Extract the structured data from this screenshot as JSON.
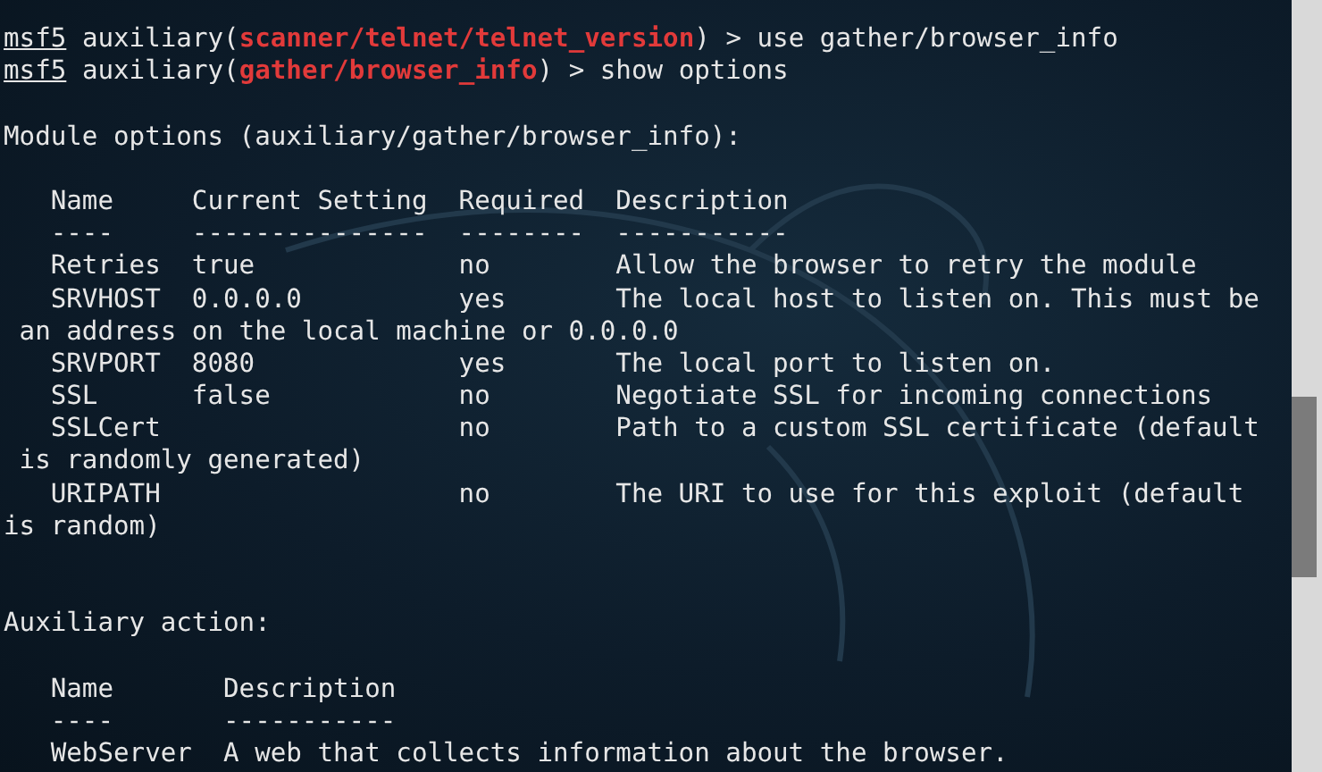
{
  "terminal": {
    "lines": [
      {
        "kind": "prompt",
        "prompt": "msf5",
        "before": " auxiliary(",
        "module": "scanner/telnet/telnet_version",
        "after": ") > use gather/browser_info"
      },
      {
        "kind": "prompt",
        "prompt": "msf5",
        "before": " auxiliary(",
        "module": "gather/browser_info",
        "after": ") > show options"
      },
      {
        "kind": "blank"
      },
      {
        "kind": "text",
        "text": "Module options (auxiliary/gather/browser_info):"
      },
      {
        "kind": "blank"
      },
      {
        "kind": "text",
        "text": "   Name     Current Setting  Required  Description"
      },
      {
        "kind": "text",
        "text": "   ----     ---------------  --------  -----------"
      },
      {
        "kind": "text",
        "text": "   Retries  true             no        Allow the browser to retry the module"
      },
      {
        "kind": "text",
        "text": "   SRVHOST  0.0.0.0          yes       The local host to listen on. This must be"
      },
      {
        "kind": "text",
        "text": " an address on the local machine or 0.0.0.0"
      },
      {
        "kind": "text",
        "text": "   SRVPORT  8080             yes       The local port to listen on."
      },
      {
        "kind": "text",
        "text": "   SSL      false            no        Negotiate SSL for incoming connections"
      },
      {
        "kind": "text",
        "text": "   SSLCert                   no        Path to a custom SSL certificate (default"
      },
      {
        "kind": "text",
        "text": " is randomly generated)"
      },
      {
        "kind": "text",
        "text": "   URIPATH                   no        The URI to use for this exploit (default"
      },
      {
        "kind": "text",
        "text": "is random)"
      },
      {
        "kind": "blank"
      },
      {
        "kind": "blank"
      },
      {
        "kind": "text",
        "text": "Auxiliary action:"
      },
      {
        "kind": "blank"
      },
      {
        "kind": "text",
        "text": "   Name       Description"
      },
      {
        "kind": "text",
        "text": "   ----       -----------"
      },
      {
        "kind": "text",
        "text": "   WebServer  A web that collects information about the browser."
      }
    ]
  }
}
